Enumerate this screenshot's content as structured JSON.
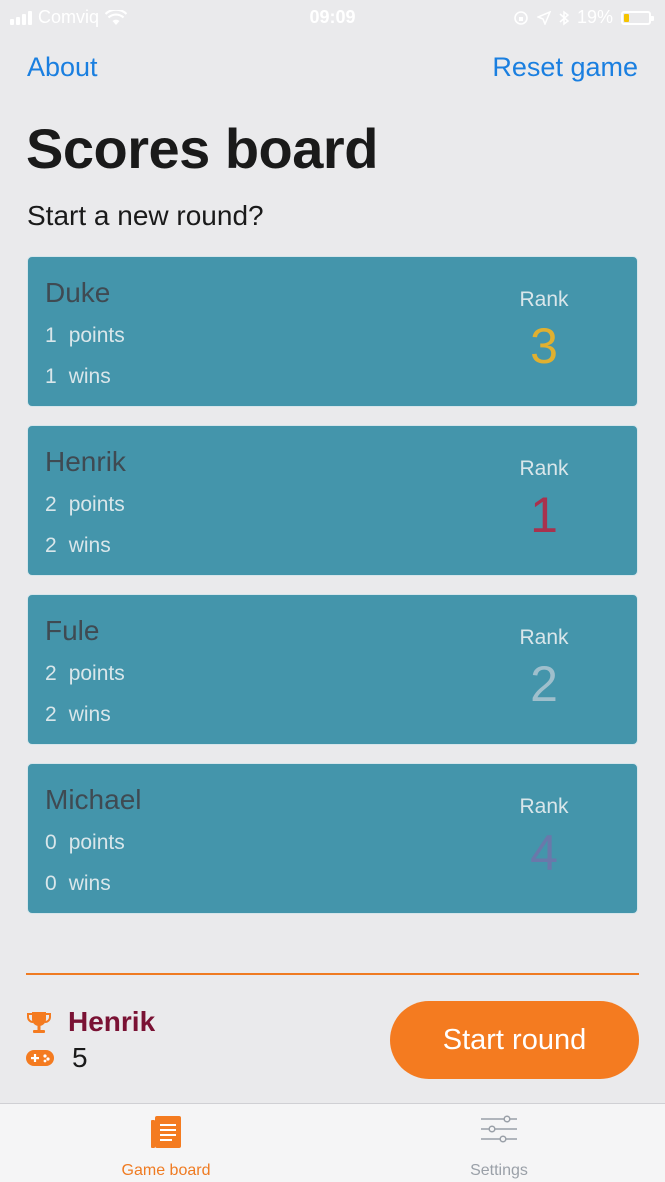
{
  "status_bar": {
    "carrier": "Comviq",
    "time": "09:09",
    "battery": "19%",
    "icons": [
      "signal-icon",
      "wifi-icon",
      "orientation-lock-icon",
      "location-icon",
      "bluetooth-icon",
      "battery-icon"
    ]
  },
  "nav": {
    "left_label": "About",
    "right_label": "Reset game"
  },
  "header": {
    "title": "Scores board",
    "subtitle": "Start a new round?"
  },
  "rank_label": "Rank",
  "players": [
    {
      "name": "Duke",
      "points": "1",
      "points_label": "points",
      "wins": "1",
      "wins_label": "wins",
      "rank": "3",
      "rank_color": "#e0b030"
    },
    {
      "name": "Henrik",
      "points": "2",
      "points_label": "points",
      "wins": "2",
      "wins_label": "wins",
      "rank": "1",
      "rank_color": "#a8324e"
    },
    {
      "name": "Fule",
      "points": "2",
      "points_label": "points",
      "wins": "2",
      "wins_label": "wins",
      "rank": "2",
      "rank_color": "#9fbfcc"
    },
    {
      "name": "Michael",
      "points": "0",
      "points_label": "points",
      "wins": "0",
      "wins_label": "wins",
      "rank": "4",
      "rank_color": "#6a78aa"
    }
  ],
  "summary": {
    "leader_name": "Henrik",
    "rounds_played": "5",
    "icons": [
      "trophy-icon",
      "gamepad-icon"
    ]
  },
  "start_button_label": "Start round",
  "tabs": [
    {
      "label": "Game board",
      "icon": "game-board-icon",
      "active": true
    },
    {
      "label": "Settings",
      "icon": "sliders-icon",
      "active": false
    }
  ],
  "colors": {
    "accent": "#f47b20",
    "link": "#1a7fe0",
    "card": "#4495ab",
    "leader": "#7a1234"
  }
}
